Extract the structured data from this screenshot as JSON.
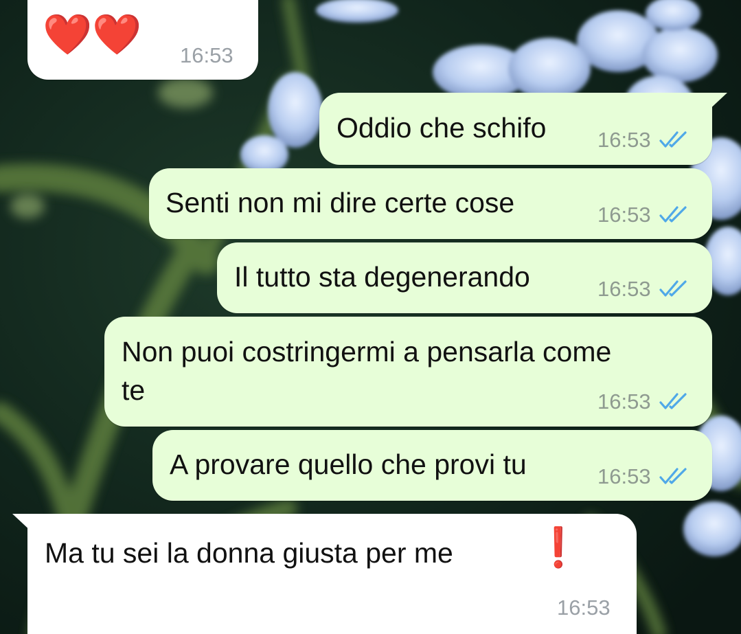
{
  "chat": {
    "messages": [
      {
        "direction": "in",
        "text": "",
        "emoji": "❤️❤️",
        "time": "16:53"
      },
      {
        "direction": "out",
        "text": "Oddio che schifo",
        "time": "16:53",
        "status": "read"
      },
      {
        "direction": "out",
        "text": "Senti non mi dire certe cose",
        "time": "16:53",
        "status": "read"
      },
      {
        "direction": "out",
        "text": "Il tutto sta degenerando",
        "time": "16:53",
        "status": "read"
      },
      {
        "direction": "out",
        "text_line1": "Non puoi costringermi a pensarla come",
        "text_line2": "te",
        "time": "16:53",
        "status": "read"
      },
      {
        "direction": "out",
        "text": "A provare quello che provi tu",
        "time": "16:53",
        "status": "read"
      },
      {
        "direction": "in",
        "text": "Ma tu sei la donna giusta per me",
        "emoji": "❗",
        "time": "16:53"
      }
    ]
  },
  "colors": {
    "outgoing_bubble": "#e7fed8",
    "incoming_bubble": "#ffffff",
    "read_tick": "#4fa8e8",
    "heart_red": "#e3262e"
  },
  "icons": {
    "read_receipt": "double-check-icon",
    "heart": "red-heart-emoji",
    "exclamation": "heavy-exclamation-mark-emoji"
  }
}
